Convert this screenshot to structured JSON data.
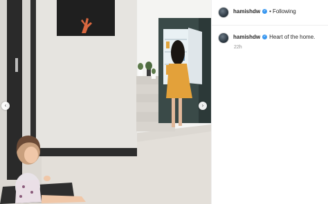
{
  "post": {
    "username": "hamishdw",
    "verified_icon": "verified-badge-icon",
    "separator": "•",
    "follow_status": "Following",
    "caption": "Heart of the home.",
    "time_ago": "22h"
  },
  "carousel": {
    "prev_glyph": "‹",
    "next_glyph": "›",
    "prev_icon": "chevron-left-icon",
    "next_icon": "chevron-right-icon"
  },
  "colors": {
    "verified_blue": "#3897f0",
    "secondary_text": "#8e8e8e",
    "primary_text": "#262626"
  }
}
